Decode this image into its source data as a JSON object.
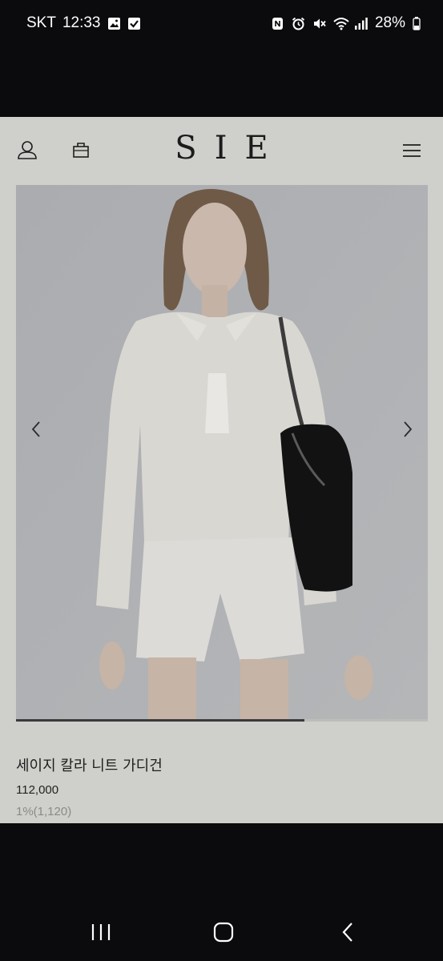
{
  "status_bar": {
    "carrier": "SKT",
    "time": "12:33",
    "battery": "28%",
    "left_icons": [
      "gallery-icon",
      "checkbox-icon"
    ],
    "right_icons": [
      "nfc-icon",
      "alarm-icon",
      "mute-icon",
      "wifi-icon",
      "signal-icon",
      "battery-icon"
    ]
  },
  "header": {
    "logo": "SIE",
    "icons": [
      "user-icon",
      "shopping-bag-icon",
      "hamburger-menu-icon"
    ]
  },
  "hero": {
    "prev_icon": "chevron-left-icon",
    "next_icon": "chevron-right-icon",
    "slide_progress": 0.7
  },
  "product": {
    "name": "세이지 칼라 니트 가디건",
    "price": "112,000",
    "points": "1%(1,120)"
  },
  "colors": {
    "page_bg": "#cfcfcb",
    "system_bg": "#0b0b0d"
  },
  "navbar": {
    "icons": [
      "recent-apps-icon",
      "home-icon",
      "back-icon"
    ]
  }
}
